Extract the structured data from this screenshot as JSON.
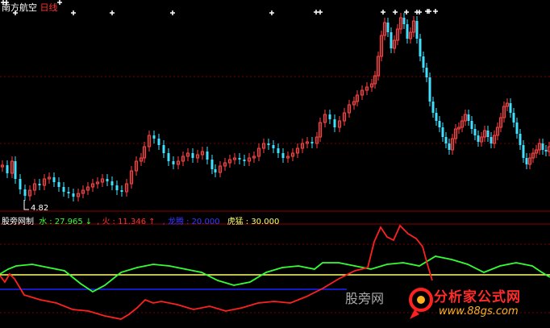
{
  "header": {
    "stock_name": "南方航空",
    "period": "日线"
  },
  "low_marker": {
    "label": "4.82"
  },
  "indicator": {
    "name": "股旁网制",
    "water": {
      "label": "水",
      "value": "27.965",
      "arrow": "↓",
      "color": "#33ff33"
    },
    "fire": {
      "label": "火",
      "value": "11.346",
      "arrow": "↑",
      "color": "#ff3030"
    },
    "dragon": {
      "label": "龙腾",
      "value": "20.000",
      "color": "#3030ff"
    },
    "tiger": {
      "label": "虎猛",
      "value": "30.000",
      "color": "#ffff66"
    }
  },
  "watermark": {
    "text": "股旁网",
    "brand": "分析家公式网",
    "url": "www.88gs.com"
  },
  "colors": {
    "up": "#ff4040",
    "down": "#40e0ff",
    "grid": "#7a0000",
    "water": "#33ff33",
    "fire": "#ff2020",
    "dragon": "#2020ff",
    "tiger": "#ffff66"
  },
  "chart_data": [
    {
      "type": "candlestick",
      "price_low_label": 4.82,
      "signal_marks": 18
    },
    {
      "type": "line",
      "series": [
        {
          "name": "水",
          "last": 27.965
        },
        {
          "name": "火",
          "last": 11.346
        },
        {
          "name": "龙腾",
          "last": 20.0
        },
        {
          "name": "虎猛",
          "last": 30.0
        }
      ]
    }
  ]
}
